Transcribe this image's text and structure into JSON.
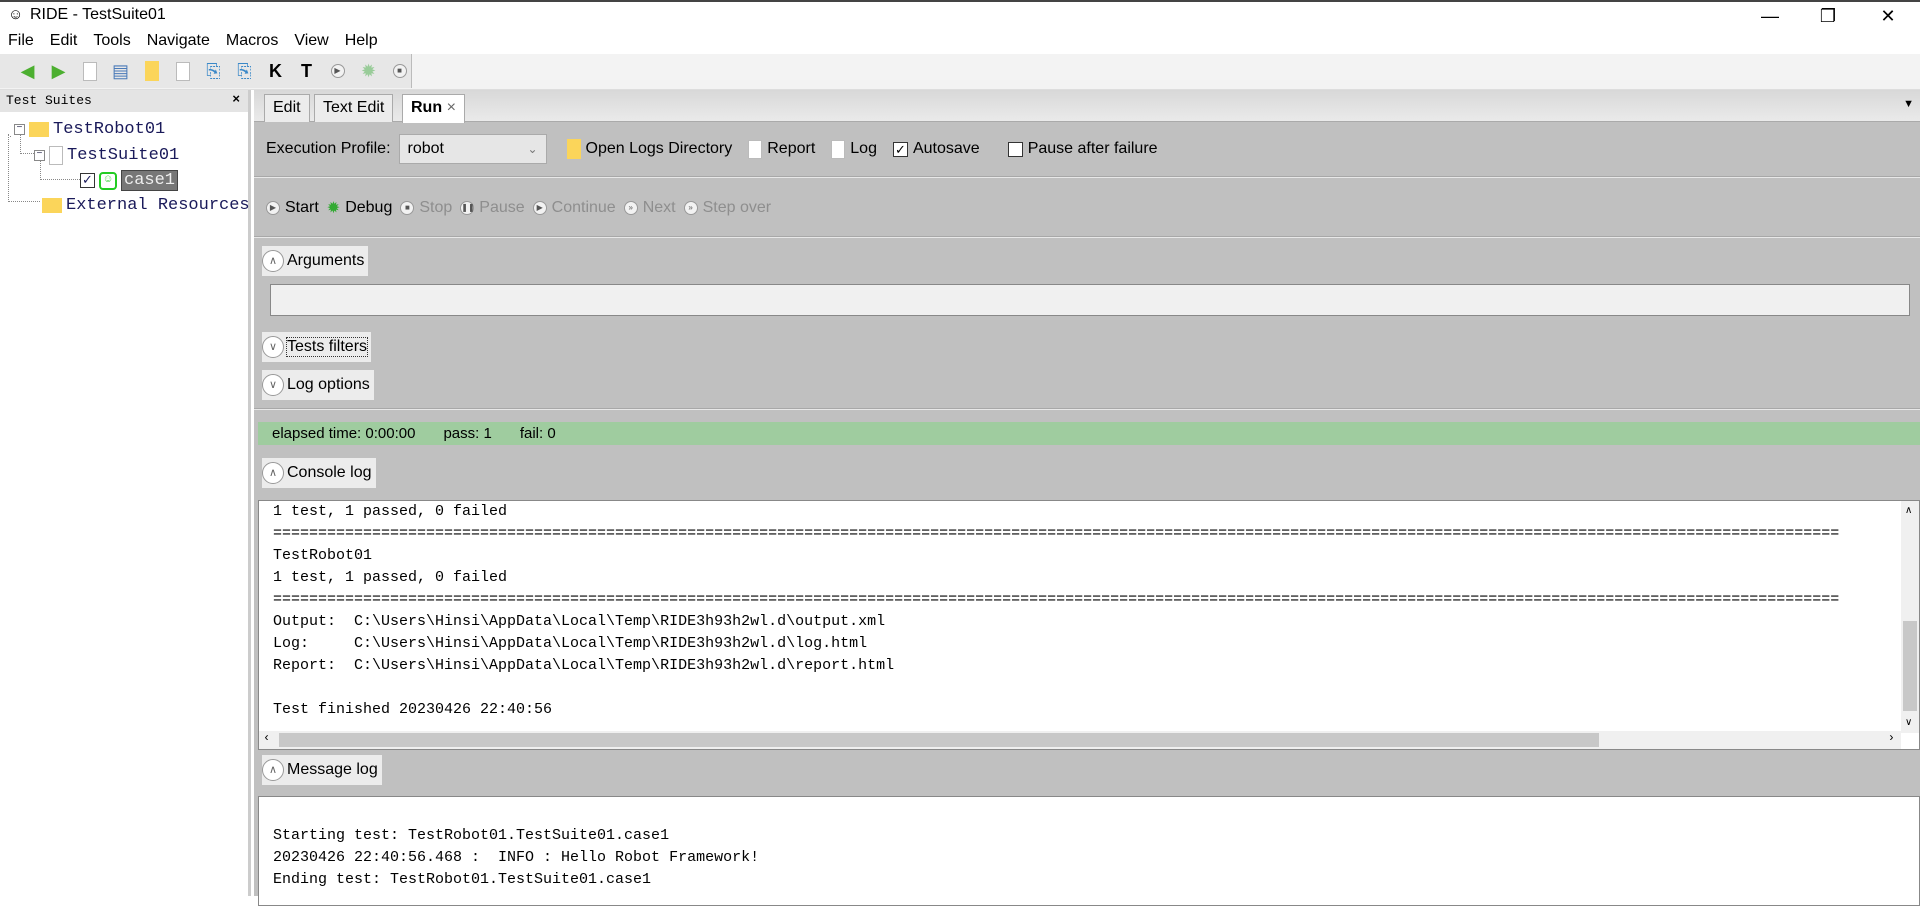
{
  "window": {
    "title": "RIDE - TestSuite01",
    "minimize": "—",
    "restore": "❐",
    "close": "✕"
  },
  "menu": [
    "File",
    "Edit",
    "Tools",
    "Navigate",
    "Macros",
    "View",
    "Help"
  ],
  "toolbar": {
    "icons": [
      "back-arrow",
      "forward-arrow",
      "new-project",
      "open-project",
      "open-directory",
      "new-file",
      "save",
      "save-all",
      "search-keywords",
      "search-tests",
      "run",
      "debug",
      "stop"
    ]
  },
  "tree": {
    "header": "Test Suites",
    "close": "×",
    "root": "TestRobot01",
    "suite": "TestSuite01",
    "case": "case1",
    "external": "External Resources"
  },
  "tabs": [
    {
      "label": "Edit"
    },
    {
      "label": "Text Edit"
    },
    {
      "label": "Run",
      "close": "×"
    }
  ],
  "run": {
    "profile_label": "Execution Profile:",
    "profile_value": "robot",
    "open_logs": "Open Logs Directory",
    "report": "Report",
    "log": "Log",
    "autosave": "Autosave",
    "autosave_checked": true,
    "pause_after_failure": "Pause after failure",
    "pause_checked": false,
    "buttons": [
      {
        "label": "Start",
        "enabled": true
      },
      {
        "label": "Debug",
        "enabled": true
      },
      {
        "label": "Stop",
        "enabled": false
      },
      {
        "label": "Pause",
        "enabled": false
      },
      {
        "label": "Continue",
        "enabled": false
      },
      {
        "label": "Next",
        "enabled": false
      },
      {
        "label": "Step over",
        "enabled": false
      }
    ],
    "arguments": "Arguments",
    "arguments_value": "",
    "tests_filters": "Tests filters",
    "log_options": "Log options",
    "status": {
      "elapsed": "elapsed time: 0:00:00",
      "pass": "pass: 1",
      "fail": "fail: 0",
      "color": "#9fcc9f"
    },
    "console_label": "Console log",
    "console": [
      "1 test, 1 passed, 0 failed",
      "==============================================================================================================================================================================",
      "TestRobot01",
      "1 test, 1 passed, 0 failed",
      "==============================================================================================================================================================================",
      "Output:  C:\\Users\\Hinsi\\AppData\\Local\\Temp\\RIDE3h93h2wl.d\\output.xml",
      "Log:     C:\\Users\\Hinsi\\AppData\\Local\\Temp\\RIDE3h93h2wl.d\\log.html",
      "Report:  C:\\Users\\Hinsi\\AppData\\Local\\Temp\\RIDE3h93h2wl.d\\report.html",
      "",
      "Test finished 20230426 22:40:56"
    ],
    "message_label": "Message log",
    "messages": [
      "",
      "Starting test: TestRobot01.TestSuite01.case1",
      "20230426 22:40:56.468 :  INFO : Hello Robot Framework!",
      "Ending test: TestRobot01.TestSuite01.case1"
    ]
  }
}
